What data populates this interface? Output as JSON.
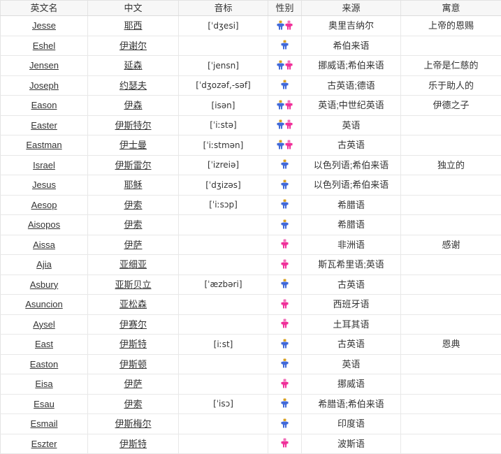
{
  "table": {
    "columns": [
      {
        "key": "english",
        "label": "英文名"
      },
      {
        "key": "chinese",
        "label": "中文"
      },
      {
        "key": "phonetic",
        "label": "音标"
      },
      {
        "key": "gender",
        "label": "性别"
      },
      {
        "key": "source",
        "label": "来源"
      },
      {
        "key": "meaning",
        "label": "寓意"
      }
    ],
    "colors": {
      "male": "#4169d8",
      "male_head": "#d8a020",
      "female": "#f0309a",
      "female_head": "#f070b8",
      "border": "#e8e8e8",
      "header_bg": "#f7f7f7",
      "text": "#333333"
    },
    "rows": [
      {
        "english": "Jesse",
        "chinese": "耶西",
        "phonetic": "[ˈdʒesi]",
        "gender": "both",
        "source": "奥里吉纳尔",
        "meaning": "上帝的恩赐"
      },
      {
        "english": "Eshel",
        "chinese": "伊谢尔",
        "phonetic": "",
        "gender": "male",
        "source": "希伯来语",
        "meaning": ""
      },
      {
        "english": "Jensen",
        "chinese": "延森",
        "phonetic": "[ˈjensn]",
        "gender": "both",
        "source": "挪威语;希伯来语",
        "meaning": "上帝是仁慈的"
      },
      {
        "english": "Joseph",
        "chinese": "约瑟夫",
        "phonetic": "[ˈdʒozəf,-səf]",
        "gender": "male",
        "source": "古英语;德语",
        "meaning": "乐于助人的"
      },
      {
        "english": "Eason",
        "chinese": "伊森",
        "phonetic": "[isən]",
        "gender": "both",
        "source": "英语;中世纪英语",
        "meaning": "伊德之子"
      },
      {
        "english": "Easter",
        "chinese": "伊斯特尔",
        "phonetic": "[ˈiːstə]",
        "gender": "both",
        "source": "英语",
        "meaning": ""
      },
      {
        "english": "Eastman",
        "chinese": "伊士曼",
        "phonetic": "[ˈiːstmən]",
        "gender": "both",
        "source": "古英语",
        "meaning": ""
      },
      {
        "english": "Israel",
        "chinese": "伊斯雷尔",
        "phonetic": "[ˈizreiə]",
        "gender": "male",
        "source": "以色列语;希伯来语",
        "meaning": "独立的"
      },
      {
        "english": "Jesus",
        "chinese": "耶稣",
        "phonetic": "[ˈdʒizəs]",
        "gender": "male",
        "source": "以色列语;希伯来语",
        "meaning": ""
      },
      {
        "english": "Aesop",
        "chinese": "伊索",
        "phonetic": "[ˈiːsɔp]",
        "gender": "male",
        "source": "希腊语",
        "meaning": ""
      },
      {
        "english": "Aisopos",
        "chinese": "伊索",
        "phonetic": "",
        "gender": "male",
        "source": "希腊语",
        "meaning": ""
      },
      {
        "english": "Aissa",
        "chinese": "伊萨",
        "phonetic": "",
        "gender": "female",
        "source": "非洲语",
        "meaning": "感谢"
      },
      {
        "english": "Ajia",
        "chinese": "亚细亚",
        "phonetic": "",
        "gender": "female",
        "source": "斯瓦希里语;英语",
        "meaning": ""
      },
      {
        "english": "Asbury",
        "chinese": "亚斯贝立",
        "phonetic": "[ˈæzbəri]",
        "gender": "male",
        "source": "古英语",
        "meaning": ""
      },
      {
        "english": "Asuncion",
        "chinese": "亚松森",
        "phonetic": "",
        "gender": "female",
        "source": "西班牙语",
        "meaning": ""
      },
      {
        "english": "Aysel",
        "chinese": "伊赛尔",
        "phonetic": "",
        "gender": "female",
        "source": "土耳其语",
        "meaning": ""
      },
      {
        "english": "East",
        "chinese": "伊斯特",
        "phonetic": "[iːst]",
        "gender": "male",
        "source": "古英语",
        "meaning": "恩典"
      },
      {
        "english": "Easton",
        "chinese": "伊斯顿",
        "phonetic": "",
        "gender": "male",
        "source": "英语",
        "meaning": ""
      },
      {
        "english": "Eisa",
        "chinese": "伊萨",
        "phonetic": "",
        "gender": "female",
        "source": "挪威语",
        "meaning": ""
      },
      {
        "english": "Esau",
        "chinese": "伊索",
        "phonetic": "[ˈisɔ]",
        "gender": "male",
        "source": "希腊语;希伯来语",
        "meaning": ""
      },
      {
        "english": "Esmail",
        "chinese": "伊斯梅尔",
        "phonetic": "",
        "gender": "male",
        "source": "印度语",
        "meaning": ""
      },
      {
        "english": "Eszter",
        "chinese": "伊斯特",
        "phonetic": "",
        "gender": "female",
        "source": "波斯语",
        "meaning": ""
      }
    ]
  }
}
